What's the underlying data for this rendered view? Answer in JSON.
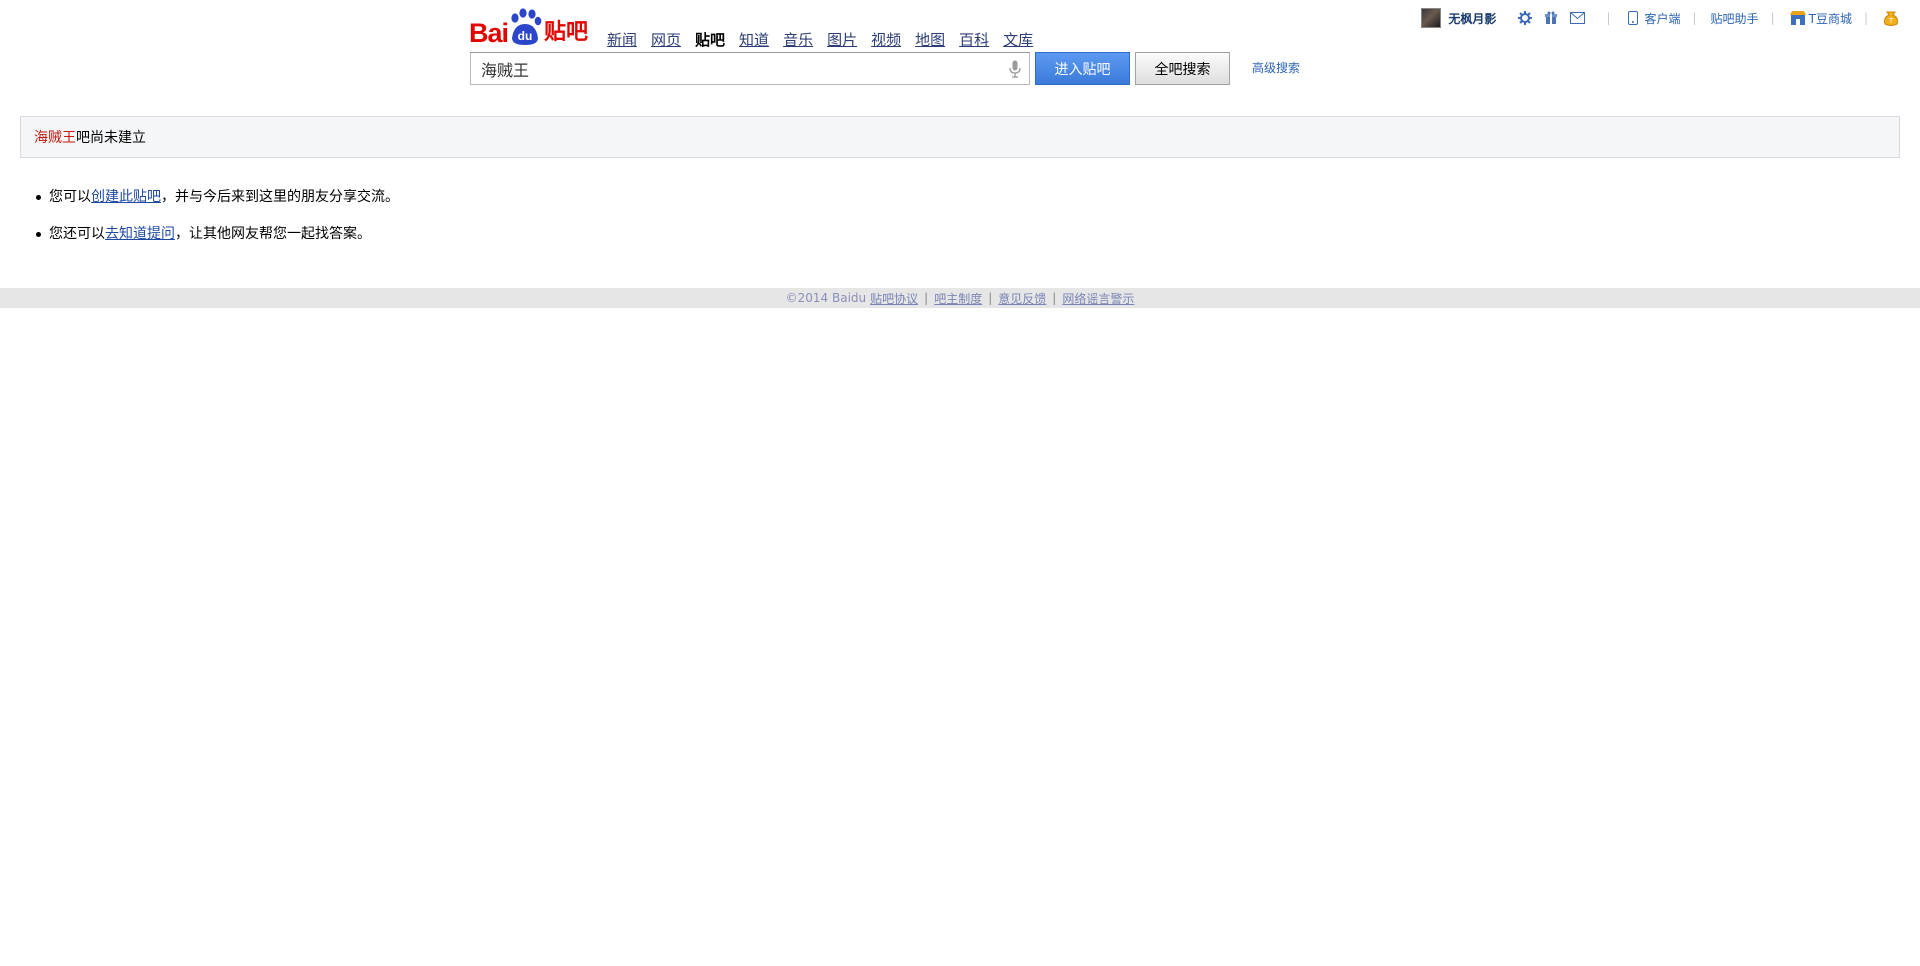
{
  "userbar": {
    "username": "无枫月影",
    "client": "客户端",
    "assistant": "贴吧助手",
    "tshop": "T豆商城",
    "separator": "|"
  },
  "nav": {
    "items": [
      "新闻",
      "网页",
      "贴吧",
      "知道",
      "音乐",
      "图片",
      "视频",
      "地图",
      "百科",
      "文库"
    ],
    "active": "贴吧"
  },
  "logo": {
    "bai": "Bai",
    "du": "du",
    "ba": "贴吧"
  },
  "search": {
    "value": "海贼王",
    "enter_label": "进入贴吧",
    "all_label": "全吧搜索",
    "advanced": "高级搜索"
  },
  "notice": {
    "keyword": "海贼王",
    "text": "吧尚未建立"
  },
  "tips": {
    "t1_pre": "您可以",
    "t1_link": "创建此贴吧",
    "t1_post": "，并与今后来到这里的朋友分享交流。",
    "t2_pre": "您还可以",
    "t2_link": "去知道提问",
    "t2_post": "，让其他网友帮您一起找答案。"
  },
  "footer": {
    "copyright": "©2014 Baidu",
    "links": [
      "贴吧协议",
      "吧主制度",
      "意见反馈",
      "网络谣言警示"
    ],
    "separator": "|"
  },
  "colors": {
    "accent": "#3b7ad9",
    "brand_red": "#e10601",
    "link": "#2d64b3"
  }
}
